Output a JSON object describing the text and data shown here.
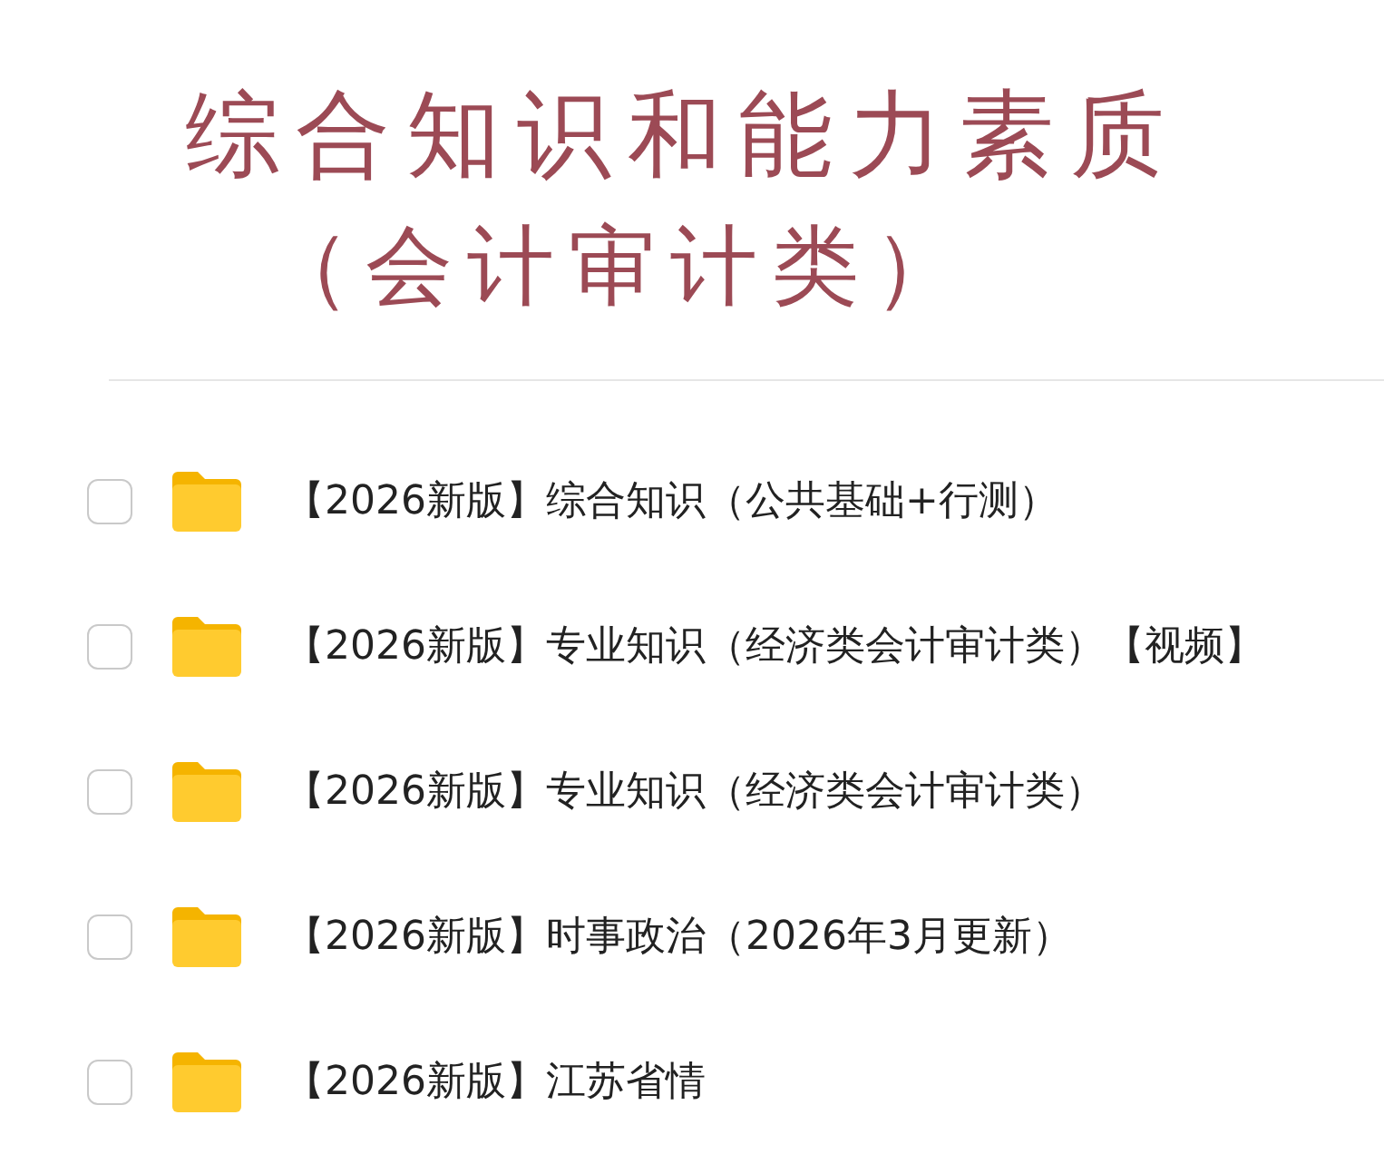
{
  "banner": {
    "title_lines": [
      "综合知识和能力素质",
      "（会计审计类）"
    ]
  },
  "files": [
    {
      "name": "【2026新版】综合知识（公共基础+行测）",
      "checked": false
    },
    {
      "name": "【2026新版】专业知识（经济类会计审计类）【视频】",
      "checked": false
    },
    {
      "name": "【2026新版】专业知识（经济类会计审计类）",
      "checked": false
    },
    {
      "name": "【2026新版】时事政治（2026年3月更新）",
      "checked": false
    },
    {
      "name": "【2026新版】江苏省情",
      "checked": false
    }
  ]
}
